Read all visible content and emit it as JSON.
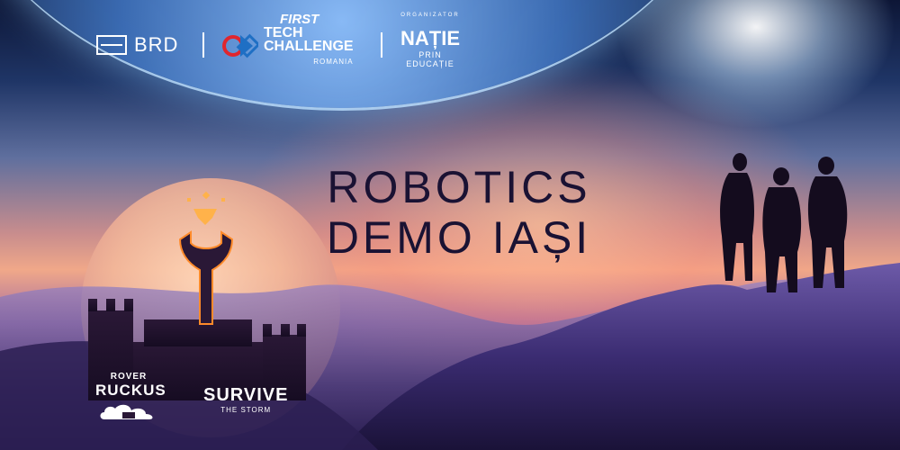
{
  "header": {
    "sponsor": "BRD",
    "program": {
      "first": "FIRST",
      "tech": "TECH",
      "challenge": "CHALLENGE",
      "country": "ROMANIA"
    },
    "organizer": {
      "label": "ORGANIZATOR",
      "name": "NAȚIE",
      "subtitle": "PRIN EDUCAȚIE"
    }
  },
  "event": {
    "line1": "ROBOTICS",
    "line2": "DEMO IAȘI"
  },
  "games": {
    "rover_top": "ROVER",
    "rover_main": "RUCKUS",
    "survive_main": "SURVIVE",
    "survive_sub": "THE STORM"
  },
  "colors": {
    "title": "#1a1233",
    "logo": "#ffffff",
    "ftc_red": "#e0262e",
    "ftc_blue": "#1f6fc4"
  }
}
